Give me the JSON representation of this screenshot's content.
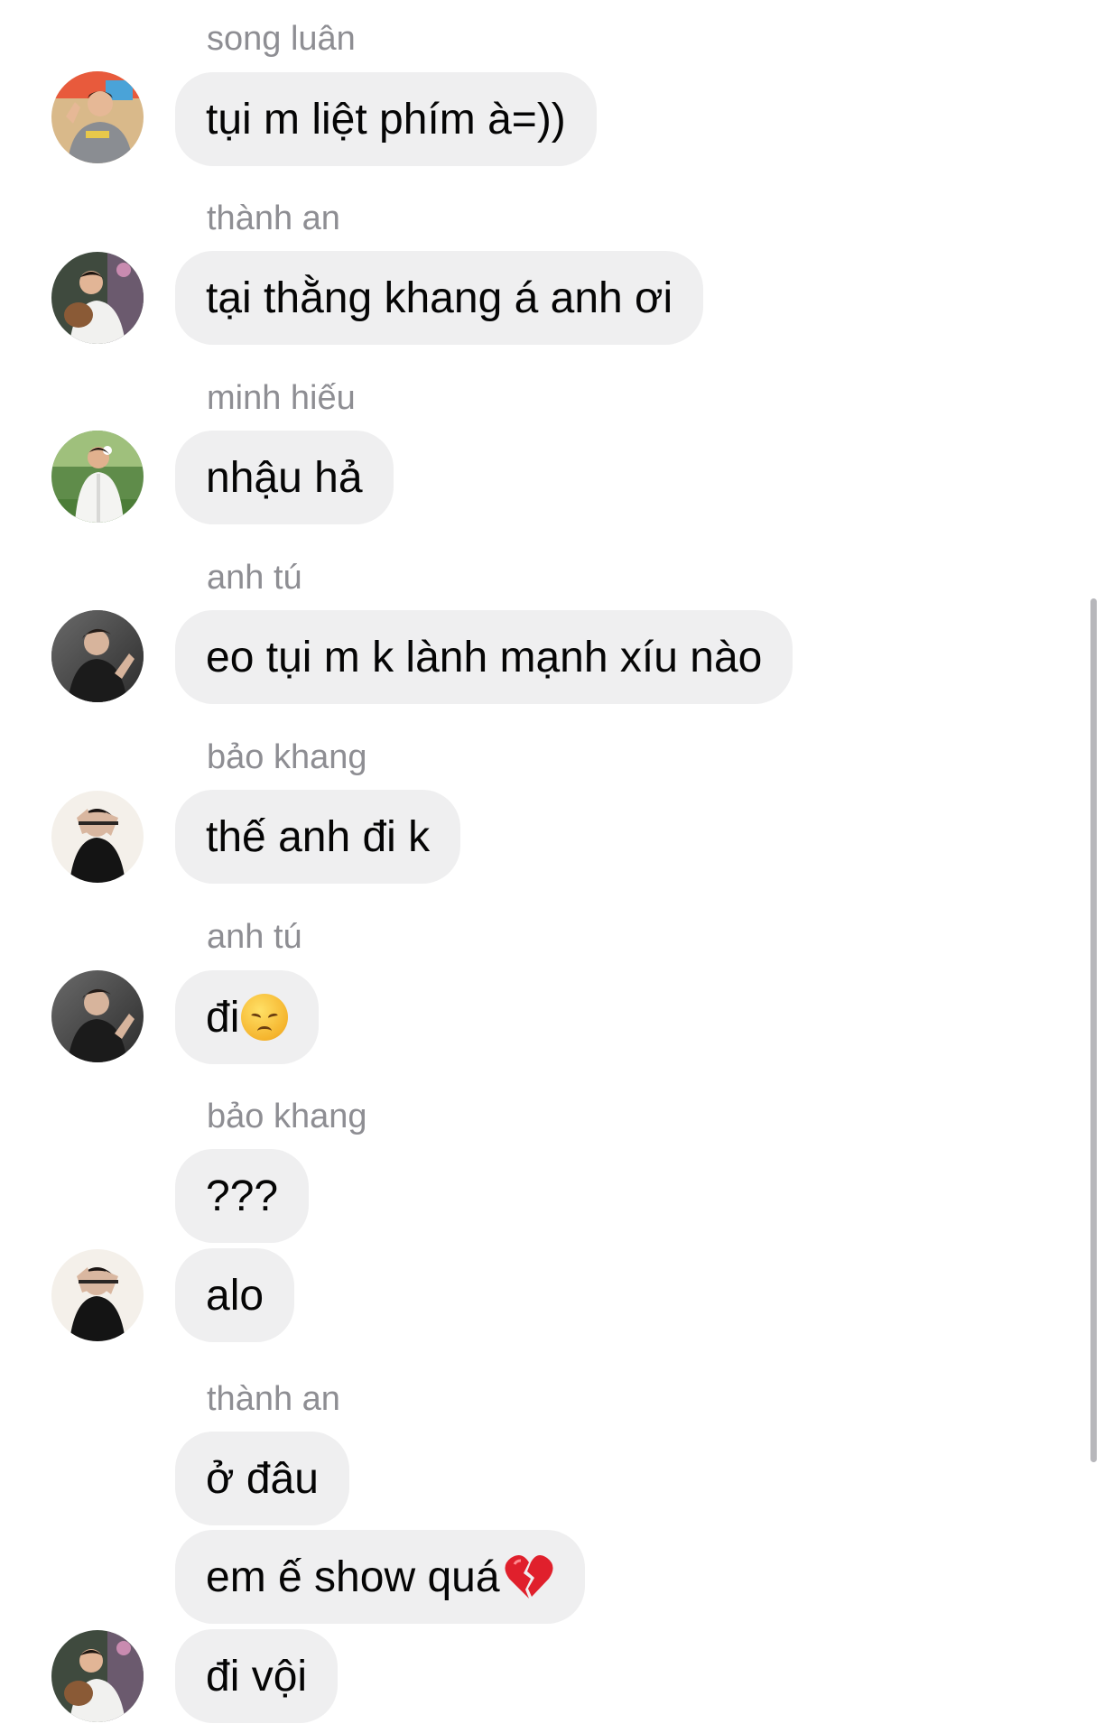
{
  "chat": {
    "messages": [
      {
        "sender": "song luân",
        "text": "tụi m liệt phím à=))"
      },
      {
        "sender": "thành an",
        "text": "tại thằng khang á anh ơi"
      },
      {
        "sender": "minh hiếu",
        "text": "nhậu hả"
      },
      {
        "sender": "anh tú",
        "text": "eo tụi m k lành mạnh xíu nào"
      },
      {
        "sender": "bảo khang",
        "text": "thế anh đi k"
      },
      {
        "sender": "anh tú",
        "text": "đi",
        "emoji": "disappointed-face"
      },
      {
        "sender": "bảo khang",
        "text": "???"
      },
      {
        "text": "alo"
      },
      {
        "sender": "thành an",
        "text": "ở đâu"
      },
      {
        "text": "em ế show quá",
        "emoji": "broken-heart"
      },
      {
        "text": "đi vội"
      }
    ]
  },
  "colors": {
    "bubble": "#efeff0",
    "sender_name": "#8e8e93",
    "message_text": "#050505",
    "scrollbar": "#b7b7bb"
  }
}
